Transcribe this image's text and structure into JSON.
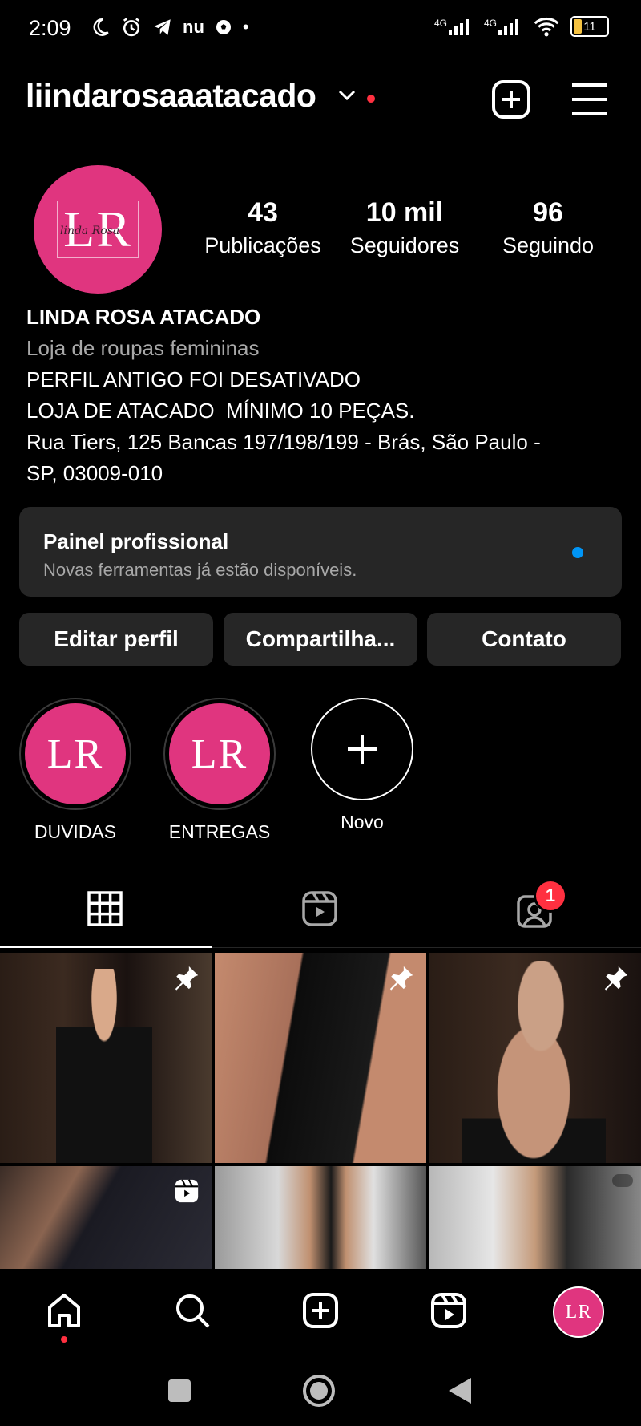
{
  "status": {
    "time": "2:09",
    "net1": "4G",
    "net2": "4G",
    "battery": "11"
  },
  "header": {
    "username": "liindarosaaatacado"
  },
  "avatar": {
    "initials": "LR",
    "script": "linda Rosa"
  },
  "stats": [
    {
      "value": "43",
      "label": "Publicações"
    },
    {
      "value": "10 mil",
      "label": "Seguidores"
    },
    {
      "value": "96",
      "label": "Seguindo"
    }
  ],
  "bio": {
    "name": "LINDA ROSA ATACADO",
    "category": "Loja de roupas femininas",
    "line1": "PERFIL ANTIGO FOI DESATIVADO",
    "line2": "LOJA DE ATACADO  MÍNIMO 10 PEÇAS.",
    "line3": "Rua Tiers, 125 Bancas 197/198/199 - Brás, São Paulo -",
    "line4": "SP, 03009-010"
  },
  "panel": {
    "title": "Painel profissional",
    "subtitle": "Novas ferramentas já estão disponíveis."
  },
  "buttons": {
    "edit": "Editar perfil",
    "share": "Compartilha...",
    "contact": "Contato"
  },
  "highlights": [
    {
      "label": "DUVIDAS"
    },
    {
      "label": "ENTREGAS"
    },
    {
      "label": "Novo"
    }
  ],
  "tabs": {
    "tagged_badge": "1"
  },
  "colors": {
    "brand_pink": "#e0357f",
    "notify_red": "#ff3040",
    "accent_blue": "#0095f6"
  }
}
